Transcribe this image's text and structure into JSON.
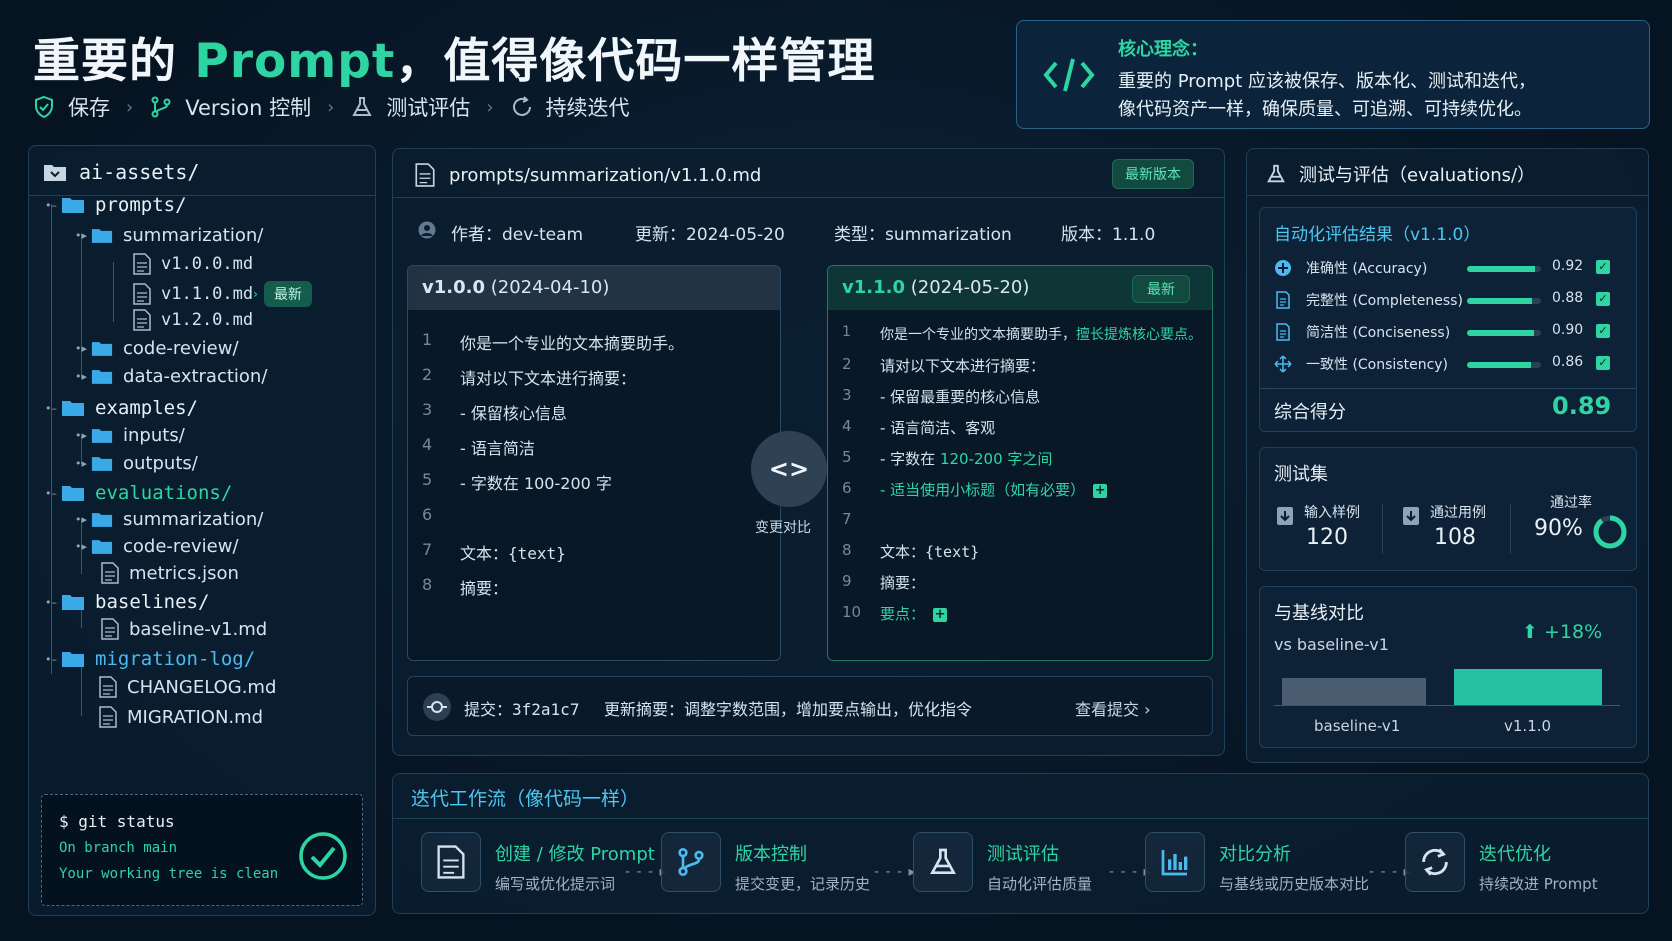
{
  "header": {
    "title_pre": "重要的 ",
    "title_accent": "Prompt",
    "title_post": "，值得像代码一样管理",
    "steps": [
      "保存",
      "Version 控制",
      "测试评估",
      "持续迭代"
    ]
  },
  "concept": {
    "title": "核心理念：",
    "line1": "重要的 Prompt 应该被保存、版本化、测试和迭代，",
    "line2": "像代码资产一样，确保质量、可追溯、可持续优化。"
  },
  "tree": {
    "root": "ai-assets/",
    "prompts": "prompts/",
    "summarization": "summarization/",
    "v100": "v1.0.0.md",
    "v110": "v1.1.0.md",
    "new_tag": "最新",
    "v120": "v1.2.0.md",
    "code_review": "code-review/",
    "data_extraction": "data-extraction/",
    "examples": "examples/",
    "inputs": "inputs/",
    "outputs": "outputs/",
    "evaluations": "evaluations/",
    "eval_summarization": "summarization/",
    "eval_code_review": "code-review/",
    "metrics": "metrics.json",
    "baselines": "baselines/",
    "baseline_v1": "baseline-v1.md",
    "migration_log": "migration-log/",
    "changelog": "CHANGELOG.md",
    "migration": "MIGRATION.md",
    "terminal": {
      "cmd": "$ git status",
      "line1": "On branch main",
      "line2": "Your working tree is clean"
    }
  },
  "center": {
    "file_path": "prompts/summarization/v1.1.0.md",
    "latest_badge": "最新版本",
    "meta_author": "作者：dev-team",
    "meta_updated": "更新：2024-05-20",
    "meta_type": "类型：summarization",
    "meta_version": "版本：1.1.0",
    "old": {
      "version": "v1.0.0",
      "date": "(2024-04-10)",
      "lines": [
        {
          "n": "1",
          "t": "你是一个专业的文本摘要助手。"
        },
        {
          "n": "2",
          "t": "请对以下文本进行摘要："
        },
        {
          "n": "3",
          "t": "- 保留核心信息"
        },
        {
          "n": "4",
          "t": "- 语言简洁"
        },
        {
          "n": "5",
          "t": "- 字数在 100-200 字"
        },
        {
          "n": "6",
          "t": ""
        },
        {
          "n": "7",
          "t": "文本：{text}"
        },
        {
          "n": "8",
          "t": "摘要："
        }
      ]
    },
    "new": {
      "version": "v1.1.0",
      "date": "(2024-05-20)",
      "badge": "最新",
      "l1_a": "你是一个专业的文本摘要助手，",
      "l1_b": "擅长提炼核心要点。",
      "l2": "请对以下文本进行摘要：",
      "l3": "- 保留最重要的核心信息",
      "l4": "- 语言简洁、客观",
      "l5_a": "- 字数在 ",
      "l5_b": "120-200 字之间",
      "l6": "- 适当使用小标题（如有必要）",
      "l8": "文本：{text}",
      "l9": "摘要：",
      "l10": "要点：",
      "nums": [
        "1",
        "2",
        "3",
        "4",
        "5",
        "6",
        "7",
        "8",
        "9",
        "10"
      ]
    },
    "diff_symbol": "<>",
    "diff_label": "变更对比",
    "commit_label": "提交：",
    "commit_hash": "3f2a1c7",
    "commit_summary": "更新摘要：调整字数范围，增加要点输出，优化指令",
    "view_commit": "查看提交 ›"
  },
  "right": {
    "title": "测试与评估（evaluations/）",
    "results_title": "自动化评估结果（v1.1.0）",
    "metrics": [
      {
        "label": "准确性 (Accuracy)",
        "value": "0.92",
        "fraction": 0.92,
        "icon": "target-icon"
      },
      {
        "label": "完整性 (Completeness)",
        "value": "0.88",
        "fraction": 0.88,
        "icon": "document-icon"
      },
      {
        "label": "简洁性 (Conciseness)",
        "value": "0.90",
        "fraction": 0.9,
        "icon": "document-icon"
      },
      {
        "label": "一致性 (Consistency)",
        "value": "0.86",
        "fraction": 0.86,
        "icon": "move-icon"
      }
    ],
    "overall_label": "综合得分",
    "overall_value": "0.89",
    "testset_title": "测试集",
    "input_samples_label": "输入样例",
    "input_samples_value": "120",
    "passed_label": "通过用例",
    "passed_value": "108",
    "pass_rate_label": "通过率",
    "pass_rate_value": "90%",
    "pass_rate_fraction": 0.9,
    "baseline_title": "与基线对比",
    "baseline_vs": "vs baseline-v1",
    "baseline_delta": "+18%",
    "baseline_bar_label": "baseline-v1",
    "current_bar_label": "v1.1.0"
  },
  "flow": {
    "title": "迭代工作流（像代码一样）",
    "steps": [
      {
        "title": "创建 / 修改 Prompt",
        "desc": "编写或优化提示词"
      },
      {
        "title": "版本控制",
        "desc": "提交变更，记录历史"
      },
      {
        "title": "测试评估",
        "desc": "自动化评估质量"
      },
      {
        "title": "对比分析",
        "desc": "与基线或历史版本对比"
      },
      {
        "title": "迭代优化",
        "desc": "持续改进 Prompt"
      }
    ],
    "arrow": "- - - ▸"
  },
  "colors": {
    "accent": "#2ed5a3",
    "background": "#071628",
    "panel_border": "#1f4058"
  }
}
